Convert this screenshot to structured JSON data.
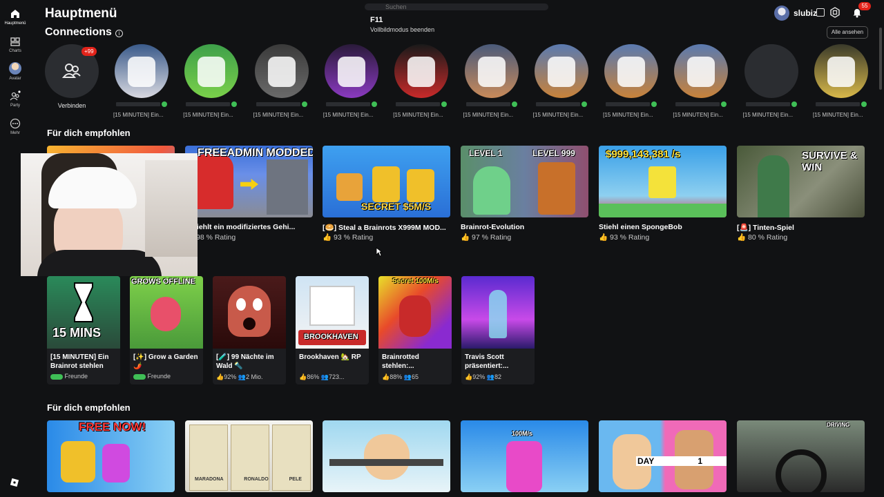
{
  "nav": {
    "items": [
      {
        "label": "Hauptmenü",
        "icon": "home-icon"
      },
      {
        "label": "Charts",
        "icon": "charts-icon"
      },
      {
        "label": "Avatar",
        "icon": "avatar-icon"
      },
      {
        "label": "Party",
        "icon": "party-icon"
      },
      {
        "label": "Mehr",
        "icon": "more-icon"
      }
    ]
  },
  "header": {
    "title": "Hauptmenü",
    "search_placeholder": "Suchen",
    "tooltip_key": "F11",
    "tooltip_desc": "Vollbildmodus beenden",
    "username": "slubiz",
    "notification_count": "55"
  },
  "connections": {
    "title": "Connections",
    "see_all": "Alle ansehen",
    "add_label": "Verbinden",
    "add_badge": "+99",
    "status_text": "[15 MINUTEN] Ein...",
    "count": 11
  },
  "recommended1": {
    "title": "Für dich empfohlen",
    "tiles": [
      {
        "name": "] Stiehlt ein modifiziertes Gehi...",
        "rating": "98 % Rating",
        "art": "FREEADMIN MODDED"
      },
      {
        "name": "[🥯] Steal a Brainrots X999M MOD...",
        "rating": "93 % Rating",
        "art": "SECRET $5M/S"
      },
      {
        "name": "Brainrot-Evolution",
        "rating": "97 % Rating",
        "art_a": "LEVEL 1",
        "art_b": "LEVEL 999"
      },
      {
        "name": "Stiehl einen SpongeBob",
        "rating": "93 % Rating",
        "art": "$999,143,381 /s"
      },
      {
        "name": "[🚨] Tinten-Spiel",
        "rating": "80 % Rating",
        "art": "SURVIVE & WIN"
      }
    ]
  },
  "small_tiles": [
    {
      "name": "[15 MINUTEN] Ein Brainrot stehlen",
      "meta": "Freunde",
      "art": "15 MINS"
    },
    {
      "name": "[✨] Grow a Garden 🌶️",
      "meta": "Freunde",
      "art": "GROWS OFFLINE"
    },
    {
      "name": "[🧪] 99 Nächte im Wald 🔦",
      "meta_rating": "92%",
      "meta_players": "2 Mio.",
      "art": ""
    },
    {
      "name": "Brookhaven 🏡 RP",
      "meta_rating": "86%",
      "meta_players": "723...",
      "art": "BROOKHAVEN"
    },
    {
      "name": "Brainrotted stehlen:...",
      "meta_rating": "88%",
      "meta_players": "65",
      "art": "Secret 100M/s"
    },
    {
      "name": "Travis Scott präsentiert:...",
      "meta_rating": "92%",
      "meta_players": "82",
      "art": ""
    }
  ],
  "recommended2": {
    "title": "Für dich empfohlen",
    "arts": [
      "FREE NOW!",
      "MARADONA RONALDO PELE",
      "",
      "100M/s",
      "DAY 1 DAY 100",
      "DRIVING"
    ]
  }
}
